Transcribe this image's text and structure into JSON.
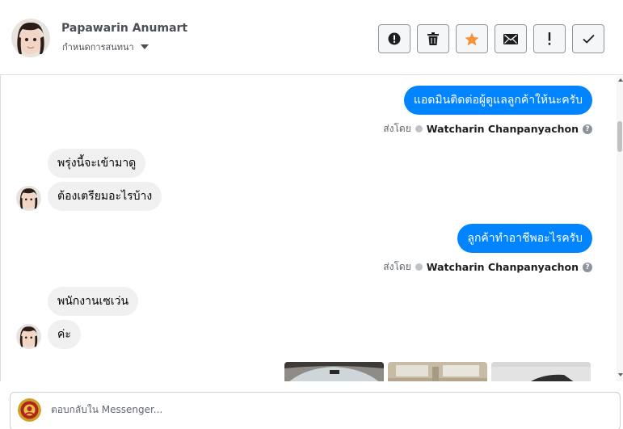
{
  "header": {
    "name": "Papawarin Anumart",
    "assign_label": "กำหนดการสนทนา",
    "actions": [
      {
        "name": "spam-button",
        "icon": "alert-circle-icon"
      },
      {
        "name": "delete-button",
        "icon": "trash-icon"
      },
      {
        "name": "star-button",
        "icon": "star-icon"
      },
      {
        "name": "mark-unread-button",
        "icon": "envelope-icon"
      },
      {
        "name": "follow-up-button",
        "icon": "exclamation-icon"
      },
      {
        "name": "mark-done-button",
        "icon": "check-icon"
      }
    ]
  },
  "messages": [
    {
      "id": "m1",
      "dir": "out",
      "text": "แอดมินติดต่อผู้ดูแลลูกค้าให้นะครับ"
    },
    {
      "id": "m1s",
      "sent_prefix": "ส่งโดย",
      "agent": "Watcharin Chanpanyachon"
    },
    {
      "id": "m2",
      "dir": "in",
      "text": "พรุ่งนี้จะเข้ามาดู"
    },
    {
      "id": "m3",
      "dir": "in",
      "text": "ต้องเตรียมอะไรบ้าง"
    },
    {
      "id": "m4",
      "dir": "out",
      "text": "ลูกค้าทำอาชีพอะไรครับ"
    },
    {
      "id": "m4s",
      "sent_prefix": "ส่งโดย",
      "agent": "Watcharin Chanpanyachon"
    },
    {
      "id": "m5",
      "dir": "in",
      "text": "พนักงานเซเว่น"
    },
    {
      "id": "m6",
      "dir": "in",
      "text": "ค่ะ"
    }
  ],
  "reply": {
    "placeholder": "ตอบกลับใน Messenger..."
  },
  "colors": {
    "outgoing_bubble": "#0084ff",
    "incoming_bubble": "#f0f0f0",
    "star": "#f7923b"
  }
}
